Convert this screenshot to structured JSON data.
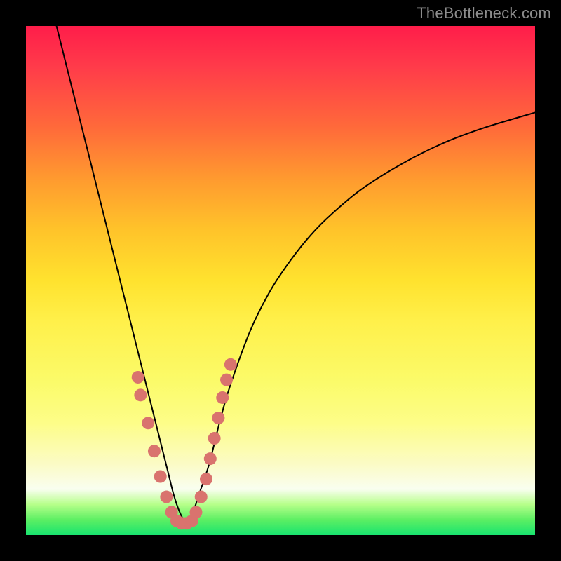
{
  "watermark": "TheBottleneck.com",
  "colors": {
    "frame": "#000000",
    "curve": "#000000",
    "marker": "#d9736e",
    "gradient_top": "#ff1d4a",
    "gradient_bottom": "#18e46f"
  },
  "chart_data": {
    "type": "line",
    "title": "",
    "xlabel": "",
    "ylabel": "",
    "xlim": [
      0,
      100
    ],
    "ylim": [
      0,
      100
    ],
    "grid": false,
    "legend": false,
    "series": [
      {
        "name": "bottleneck-curve",
        "x": [
          6,
          8,
          10,
          12,
          14,
          16,
          18,
          20,
          22,
          24,
          26,
          27,
          28,
          29,
          30,
          31,
          32,
          33,
          34,
          36,
          38,
          40,
          44,
          48,
          52,
          56,
          60,
          66,
          74,
          82,
          90,
          100
        ],
        "y": [
          100,
          92,
          84,
          76,
          68,
          60,
          52,
          44,
          36,
          28,
          20,
          16,
          12,
          8,
          5,
          3,
          3,
          5,
          8,
          14,
          22,
          29,
          40,
          48,
          54,
          59,
          63,
          68,
          73,
          77,
          80,
          83
        ]
      }
    ],
    "markers": {
      "name": "highlighted-points",
      "comment": "dense pink markers near the curve minimum",
      "x": [
        22.0,
        22.5,
        24.0,
        25.2,
        26.4,
        27.6,
        28.6,
        29.6,
        30.6,
        31.6,
        32.6,
        33.4,
        34.4,
        35.4,
        36.2,
        37.0,
        37.8,
        38.6,
        39.4,
        40.2
      ],
      "y": [
        31.0,
        27.5,
        22.0,
        16.5,
        11.5,
        7.5,
        4.5,
        2.8,
        2.3,
        2.3,
        2.8,
        4.5,
        7.5,
        11.0,
        15.0,
        19.0,
        23.0,
        27.0,
        30.5,
        33.5
      ]
    }
  }
}
